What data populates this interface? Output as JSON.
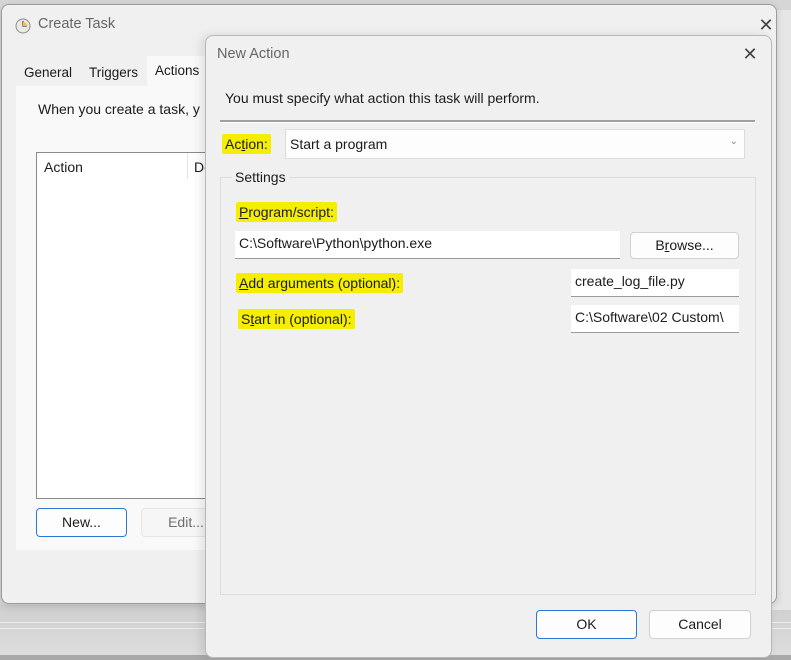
{
  "main_window": {
    "title": "Create Task",
    "close_glyph": "✕",
    "tabs": [
      {
        "label": "General",
        "active": false
      },
      {
        "label": "Triggers",
        "active": false
      },
      {
        "label": "Actions",
        "active": true
      }
    ],
    "description": "When you create a task, y",
    "list_columns": [
      "Action",
      "De"
    ],
    "buttons": {
      "new": "New...",
      "edit": "Edit..."
    }
  },
  "dialog": {
    "title": "New Action",
    "close_glyph": "✕",
    "instruction": "You must specify what action this task will perform.",
    "action_label": {
      "pre": "Ac",
      "mn": "t",
      "post": "ion:"
    },
    "action_value": "Start a program",
    "chevron_glyph": "⌄",
    "settings_legend": "Settings",
    "program_label": {
      "mn": "P",
      "post": "rogram/script:"
    },
    "program_value": "C:\\Software\\Python\\python.exe",
    "browse": {
      "pre": "B",
      "mn": "r",
      "post": "owse..."
    },
    "arguments_label": {
      "mn": "A",
      "post": "dd arguments (optional):"
    },
    "arguments_value": "create_log_file.py",
    "start_in_label": {
      "pre": "S",
      "mn": "t",
      "post": "art in (optional):"
    },
    "start_in_value": "C:\\Software\\02 Custom\\",
    "ok": "OK",
    "cancel": "Cancel"
  },
  "colors": {
    "highlight": "#f5ee00",
    "primary_border": "#2b78d4"
  }
}
